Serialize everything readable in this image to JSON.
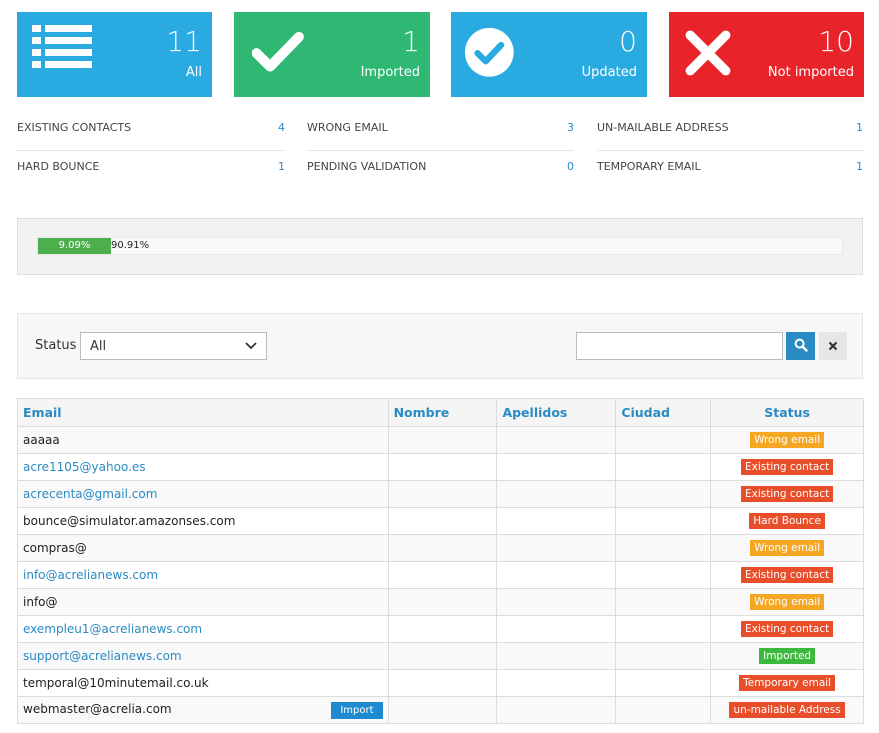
{
  "cards": [
    {
      "num": "11",
      "label": "All",
      "color": "#29abe2",
      "icon": "list-icon"
    },
    {
      "num": "1",
      "label": "Imported",
      "color": "#2eb874",
      "icon": "check-icon"
    },
    {
      "num": "0",
      "label": "Updated",
      "color": "#29abe2",
      "icon": "check-circle-icon"
    },
    {
      "num": "10",
      "label": "Not imported",
      "color": "#e8232a",
      "icon": "x-icon"
    }
  ],
  "summary": [
    [
      {
        "name": "EXISTING CONTACTS",
        "value": "4"
      },
      {
        "name": "HARD BOUNCE",
        "value": "1"
      }
    ],
    [
      {
        "name": "WRONG EMAIL",
        "value": "3"
      },
      {
        "name": "PENDING VALIDATION",
        "value": "0"
      }
    ],
    [
      {
        "name": "UN-MAILABLE ADDRESS",
        "value": "1"
      },
      {
        "name": "TEMPORARY EMAIL",
        "value": "1"
      }
    ]
  ],
  "progress": {
    "success": "9.09%",
    "remaining": "90.91%",
    "success_fraction": 0.0909
  },
  "filter": {
    "status_label": "Status",
    "status_value": "All",
    "search_value": ""
  },
  "table": {
    "headers": [
      "Email",
      "Nombre",
      "Apellidos",
      "Ciudad",
      "Status"
    ],
    "import_label": "Import",
    "rows": [
      {
        "email": "aaaaa",
        "link": false,
        "status": "Wrong email",
        "color": "orange"
      },
      {
        "email": "acre1105@yahoo.es",
        "link": true,
        "status": "Existing contact",
        "color": "red"
      },
      {
        "email": "acrecenta@gmail.com",
        "link": true,
        "status": "Existing contact",
        "color": "red"
      },
      {
        "email": "bounce@simulator.amazonses.com",
        "link": false,
        "status": "Hard Bounce",
        "color": "red"
      },
      {
        "email": "compras@",
        "link": false,
        "status": "Wrong email",
        "color": "orange"
      },
      {
        "email": "info@acrelianews.com",
        "link": true,
        "status": "Existing contact",
        "color": "red"
      },
      {
        "email": "info@",
        "link": false,
        "status": "Wrong email",
        "color": "orange"
      },
      {
        "email": "exempleu1@acrelianews.com",
        "link": true,
        "status": "Existing contact",
        "color": "red"
      },
      {
        "email": "support@acrelianews.com",
        "link": true,
        "status": "Imported",
        "color": "green"
      },
      {
        "email": "temporal@10minutemail.co.uk",
        "link": false,
        "status": "Temporary email",
        "color": "red"
      },
      {
        "email": "webmaster@acrelia.com",
        "link": false,
        "status": "un-mailable Address",
        "color": "red",
        "import": true
      }
    ]
  }
}
